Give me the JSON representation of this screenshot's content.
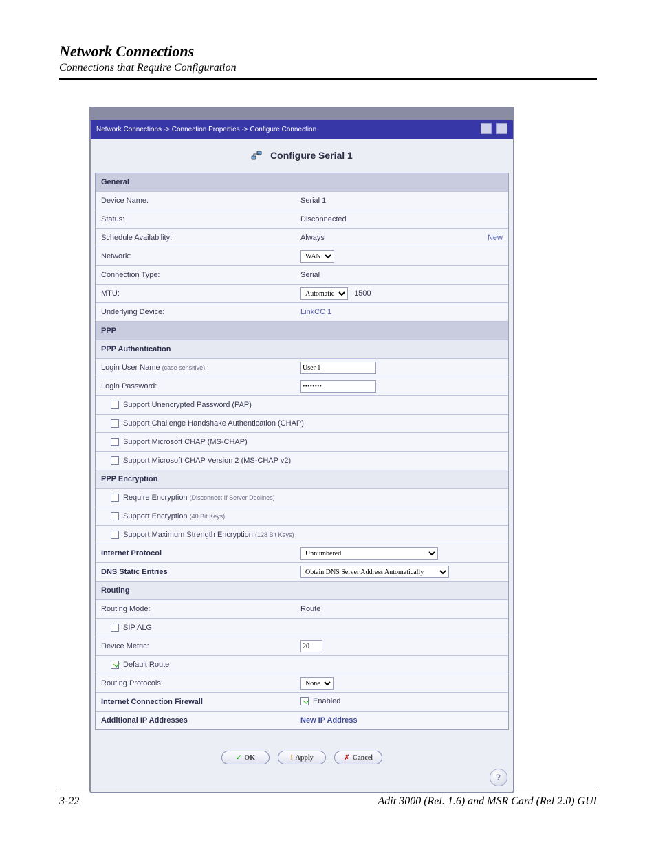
{
  "doc": {
    "title": "Network Connections",
    "subtitle": "Connections that Require Configuration",
    "page_num": "3-22",
    "product": "Adit 3000 (Rel. 1.6) and MSR Card (Rel 2.0) GUI"
  },
  "breadcrumb": "Network Connections -> Connection Properties -> Configure Connection",
  "window_title": "Configure Serial 1",
  "sections": {
    "general": "General",
    "ppp": "PPP",
    "ppp_auth": "PPP Authentication",
    "ppp_enc": "PPP Encryption",
    "ip": "Internet Protocol",
    "dns": "DNS Static Entries",
    "routing": "Routing",
    "fw": "Internet Connection Firewall",
    "addip": "Additional IP Addresses"
  },
  "labels": {
    "device_name": "Device Name:",
    "status": "Status:",
    "schedule": "Schedule Availability:",
    "network": "Network:",
    "conn_type": "Connection Type:",
    "mtu": "MTU:",
    "underlying": "Underlying Device:",
    "login_user": "Login User Name",
    "case": "(case sensitive):",
    "login_pass": "Login Password:",
    "pap": "Support Unencrypted Password (PAP)",
    "chap": "Support Challenge Handshake Authentication (CHAP)",
    "mschap": "Support Microsoft CHAP (MS-CHAP)",
    "mschap2": "Support Microsoft CHAP Version 2 (MS-CHAP v2)",
    "reqenc": "Require Encryption",
    "reqenc_note": "(Disconnect If Server Declines)",
    "enc40": "Support Encryption",
    "enc40_note": "(40 Bit Keys)",
    "enc128": "Support Maximum Strength Encryption",
    "enc128_note": "(128 Bit Keys)",
    "routing_mode": "Routing Mode:",
    "sip_alg": "SIP ALG",
    "device_metric": "Device Metric:",
    "default_route": "Default Route",
    "routing_proto": "Routing Protocols:",
    "fw_enabled": "Enabled",
    "new_ip": "New IP Address",
    "new": "New"
  },
  "values": {
    "device_name": "Serial 1",
    "status": "Disconnected",
    "schedule": "Always",
    "network_sel": "WAN",
    "conn_type": "Serial",
    "mtu_sel": "Automatic",
    "mtu_val": "1500",
    "underlying": "LinkCC 1",
    "login_user": "User 1",
    "login_pass": "••••••••",
    "ip_sel": "Unnumbered",
    "dns_sel": "Obtain DNS Server Address Automatically",
    "routing_mode": "Route",
    "device_metric": "20",
    "routing_proto": "None",
    "pap": false,
    "chap": false,
    "mschap": false,
    "mschap2": false,
    "reqenc": false,
    "enc40": false,
    "enc128": false,
    "sip_alg": false,
    "default_route": true,
    "fw_enabled": true
  },
  "buttons": {
    "ok": "OK",
    "apply": "Apply",
    "cancel": "Cancel"
  }
}
